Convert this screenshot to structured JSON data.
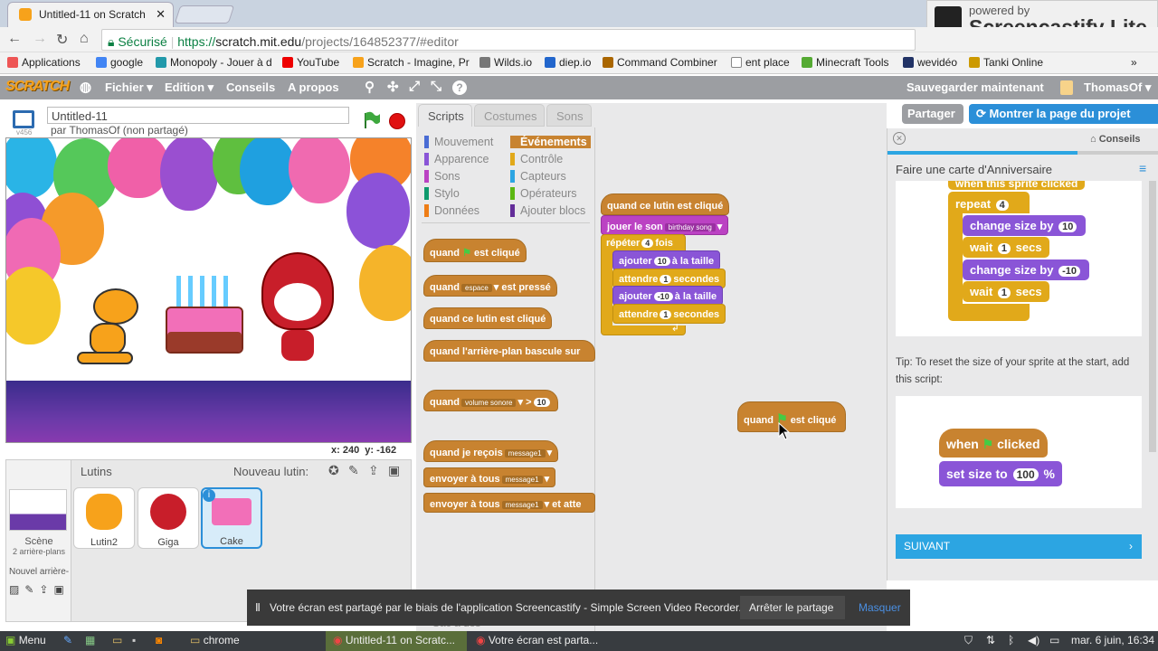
{
  "browser": {
    "tabs": [
      {
        "title": "Untitled-11 on Scratch"
      }
    ],
    "url_secure_label": "Sécurisé",
    "url_prefix": "https://",
    "url_domain": "scratch.mit.edu",
    "url_path": "/projects/164852377/#editor",
    "bookmarks": [
      "Applications",
      "google",
      "Monopoly - Jouer à d",
      "YouTube",
      "Scratch - Imagine, Pr",
      "Wilds.io",
      "diep.io",
      "Command Combiner",
      "ent place",
      "Minecraft Tools",
      "wevidéo",
      "Tanki Online"
    ],
    "bookmarks_more": "»"
  },
  "screencastify": {
    "powered_by": "powered by",
    "brand": "Screencastify Lite"
  },
  "scratch": {
    "logo": "SCRATCH",
    "menu": [
      "Fichier ▾",
      "Edition ▾",
      "Conseils",
      "A propos"
    ],
    "save_now": "Sauvegarder maintenant",
    "user": "ThomasOf ▾",
    "share_button": "Partager",
    "see_project_button": "Montrer la page du projet",
    "project_title": "Untitled-11",
    "byline": "par ThomasOf (non partagé)",
    "version": "v456",
    "coords": "x: 240  y: -162",
    "editor_tabs": [
      "Scripts",
      "Costumes",
      "Sons"
    ],
    "categories_left": [
      "Mouvement",
      "Apparence",
      "Sons",
      "Stylo",
      "Données"
    ],
    "categories_right": [
      "Événements",
      "Contrôle",
      "Capteurs",
      "Opérateurs",
      "Ajouter blocs"
    ],
    "category_colors": {
      "Mouvement": "#4a6cd4",
      "Apparence": "#8a55d7",
      "Sons": "#bb42c3",
      "Stylo": "#0e9a6c",
      "Données": "#ee7d16",
      "Événements": "#c88330",
      "Contrôle": "#e1a91a",
      "Capteurs": "#2ca5e2",
      "Opérateurs": "#5cb712",
      "Ajouter blocs": "#632d99"
    },
    "palette": {
      "when_flag_a": "quand",
      "when_flag_b": "est cliqué",
      "when_key_a": "quand",
      "when_key_drop": "espace",
      "when_key_b": "est pressé",
      "when_sprite": "quand ce lutin est cliqué",
      "when_backdrop": "quand l'arrière-plan bascule sur",
      "when_volume_a": "quand",
      "when_volume_drop": "volume sonore",
      "when_volume_op": ">",
      "when_volume_val": "10",
      "receive_a": "quand je reçois",
      "receive_drop": "message1",
      "broadcast_a": "envoyer à tous",
      "broadcast_drop": "message1",
      "broadcast_wait_a": "envoyer à tous",
      "broadcast_wait_drop": "message1",
      "broadcast_wait_b": "et atte"
    },
    "script": {
      "hat": "quand ce lutin est cliqué",
      "play_sound": "jouer le son",
      "sound_name": "birthday song",
      "repeat_a": "répéter",
      "repeat_n": "4",
      "repeat_b": "fois",
      "add_a": "ajouter",
      "add_v1": "10",
      "add_b": "à la taille",
      "wait_a": "attendre",
      "wait_v": "1",
      "wait_b": "secondes",
      "add_v2": "-10",
      "loose_a": "quand",
      "loose_b": "est cliqué"
    },
    "tips": {
      "header": "Conseils",
      "title": "Faire une carte d'Anniversaire",
      "cut_top": "when this sprite clicked",
      "repeat": "repeat",
      "repeat_n": "4",
      "change_size": "change size by",
      "cs_v1": "10",
      "cs_v2": "-10",
      "wait": "wait",
      "wait_v": "1",
      "secs": "secs",
      "tip_text": "Tip: To reset the size of your sprite at the start, add this script:",
      "when": "when",
      "clicked": "clicked",
      "set_size": "set size to",
      "set_size_v": "100",
      "percent": "%",
      "next": "SUIVANT"
    },
    "sprites": {
      "header": "Lutins",
      "new_sprite": "Nouveau lutin:",
      "stage_label": "Scène",
      "stage_sub": "2 arrière-plans",
      "new_backdrop": "Nouvel arrière-",
      "items": [
        {
          "name": "Lutin2"
        },
        {
          "name": "Giga"
        },
        {
          "name": "Cake"
        }
      ],
      "behind_text": "Sac à dos"
    }
  },
  "notification": {
    "text": "Votre écran est partagé par le biais de l'application Screencastify - Simple Screen Video Recorder.",
    "stop": "Arrêter le partage",
    "hide": "Masquer"
  },
  "taskbar": {
    "menu": "Menu",
    "items": [
      "chrome",
      "Untitled-11 on Scratc...",
      "Votre écran est parta..."
    ],
    "clock": "mar. 6 juin, 16:34"
  }
}
